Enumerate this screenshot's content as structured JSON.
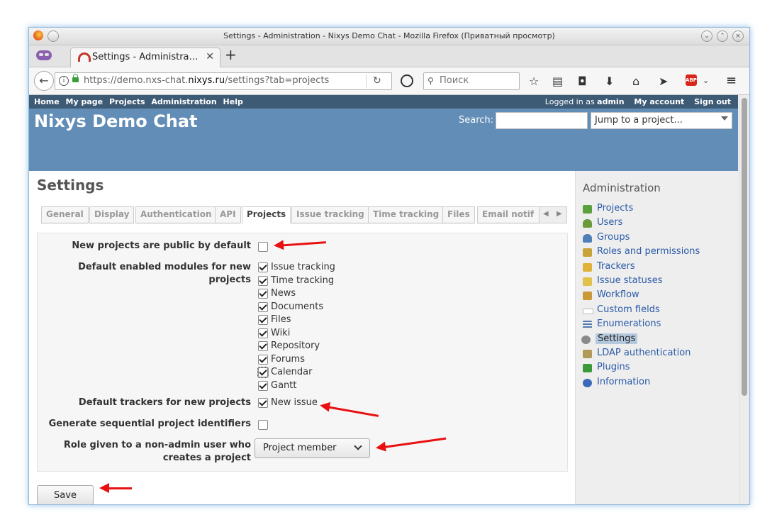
{
  "window": {
    "title": "Settings - Administration - Nixys Demo Chat - Mozilla Firefox (Приватный просмотр)"
  },
  "browser": {
    "tab_title": "Settings - Administra…",
    "url_prefix": "https://demo.nxs-chat.",
    "url_domain": "nixys.ru",
    "url_suffix": "/settings?tab=projects",
    "search_placeholder": "Поиск",
    "abp_label": "ABP"
  },
  "top_menu": {
    "items": [
      "Home",
      "My page",
      "Projects",
      "Administration",
      "Help"
    ],
    "logged_in_prefix": "Logged in as",
    "logged_in_user": "admin",
    "my_account": "My account",
    "sign_out": "Sign out"
  },
  "header": {
    "app_title": "Nixys Demo Chat",
    "search_label": "Search:",
    "jump_placeholder": "Jump to a project..."
  },
  "page": {
    "title": "Settings",
    "tabs": [
      "General",
      "Display",
      "Authentication",
      "API",
      "Projects",
      "Issue tracking",
      "Time tracking",
      "Files",
      "Email notif"
    ],
    "active_tab": "Projects"
  },
  "form": {
    "public_label": "New projects are public by default",
    "public_checked": false,
    "modules_label_1": "Default enabled modules for new",
    "modules_label_2": "projects",
    "modules": [
      {
        "label": "Issue tracking",
        "checked": true
      },
      {
        "label": "Time tracking",
        "checked": true
      },
      {
        "label": "News",
        "checked": true
      },
      {
        "label": "Documents",
        "checked": true
      },
      {
        "label": "Files",
        "checked": true
      },
      {
        "label": "Wiki",
        "checked": true
      },
      {
        "label": "Repository",
        "checked": true
      },
      {
        "label": "Forums",
        "checked": true
      },
      {
        "label": "Calendar",
        "checked": true
      },
      {
        "label": "Gantt",
        "checked": true
      }
    ],
    "trackers_label": "Default trackers for new projects",
    "trackers": [
      {
        "label": "New issue",
        "checked": true
      }
    ],
    "sequential_label": "Generate sequential project identifiers",
    "sequential_checked": false,
    "role_label_1": "Role given to a non-admin user who",
    "role_label_2": "creates a project",
    "role_value": "Project member",
    "save_label": "Save"
  },
  "sidebar": {
    "title": "Administration",
    "items": [
      {
        "label": "Projects",
        "icon": "projects-icon",
        "color": "#5aa03c"
      },
      {
        "label": "Users",
        "icon": "user-icon",
        "color": "#6b9a3a"
      },
      {
        "label": "Groups",
        "icon": "group-icon",
        "color": "#4f7fb8"
      },
      {
        "label": "Roles and permissions",
        "icon": "key-icon",
        "color": "#c8a23a"
      },
      {
        "label": "Trackers",
        "icon": "ticket-icon",
        "color": "#e0b23a"
      },
      {
        "label": "Issue statuses",
        "icon": "status-icon",
        "color": "#e0c24a"
      },
      {
        "label": "Workflow",
        "icon": "workflow-icon",
        "color": "#c89a3a"
      },
      {
        "label": "Custom fields",
        "icon": "textfield-icon",
        "color": "#ffffff"
      },
      {
        "label": "Enumerations",
        "icon": "list-icon",
        "color": "#5577aa"
      },
      {
        "label": "Settings",
        "icon": "gear-icon",
        "color": "#8a8a8a"
      },
      {
        "label": "LDAP authentication",
        "icon": "server-key-icon",
        "color": "#b09a5a"
      },
      {
        "label": "Plugins",
        "icon": "plugin-icon",
        "color": "#3a9a3a"
      },
      {
        "label": "Information",
        "icon": "info-icon",
        "color": "#3a6ab8"
      }
    ],
    "selected": "Settings"
  }
}
